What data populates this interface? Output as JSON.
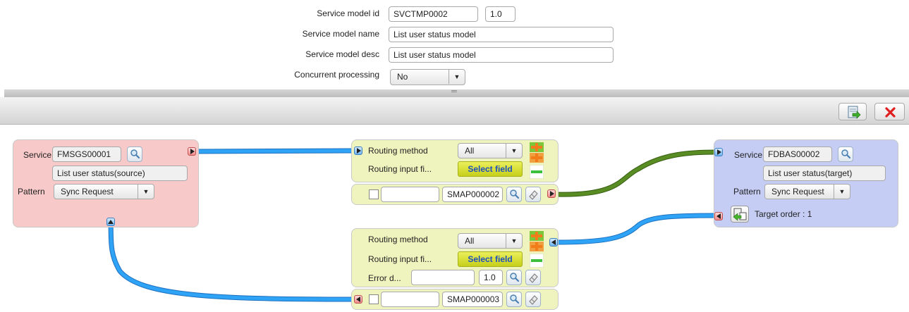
{
  "form": {
    "model_id_label": "Service model id",
    "model_id_value": "SVCTMP0002",
    "version_value": "1.0",
    "model_name_label": "Service model name",
    "model_name_value": "List user status model",
    "model_desc_label": "Service model desc",
    "model_desc_value": "List user status model",
    "concurrent_label": "Concurrent processing",
    "concurrent_value": "No"
  },
  "toolbar": {
    "splitter_glyph": "═"
  },
  "source_node": {
    "service_label": "Service",
    "service_id": "FMSGS00001",
    "service_name": "List user status(source)",
    "pattern_label": "Pattern",
    "pattern_value": "Sync Request"
  },
  "target_node": {
    "service_label": "Service",
    "service_id": "FDBAS00002",
    "service_name": "List user status(target)",
    "pattern_label": "Pattern",
    "pattern_value": "Sync Request",
    "target_order_text": "Target order : 1"
  },
  "routing_top": {
    "method_label": "Routing method",
    "method_value": "All",
    "input_label": "Routing input fi...",
    "select_field_label": "Select field",
    "map_id": "SMAP000002"
  },
  "routing_bottom": {
    "method_label": "Routing method",
    "method_value": "All",
    "input_label": "Routing input fi...",
    "select_field_label": "Select field",
    "error_label": "Error d...",
    "error_version": "1.0",
    "map_id": "SMAP000003"
  },
  "colors": {
    "source_bg": "#f8c9c9",
    "target_bg": "#c5cdf5",
    "routing_bg": "#eff4be",
    "link_blue": "#2a9df4",
    "link_green": "#4f7a1e"
  }
}
